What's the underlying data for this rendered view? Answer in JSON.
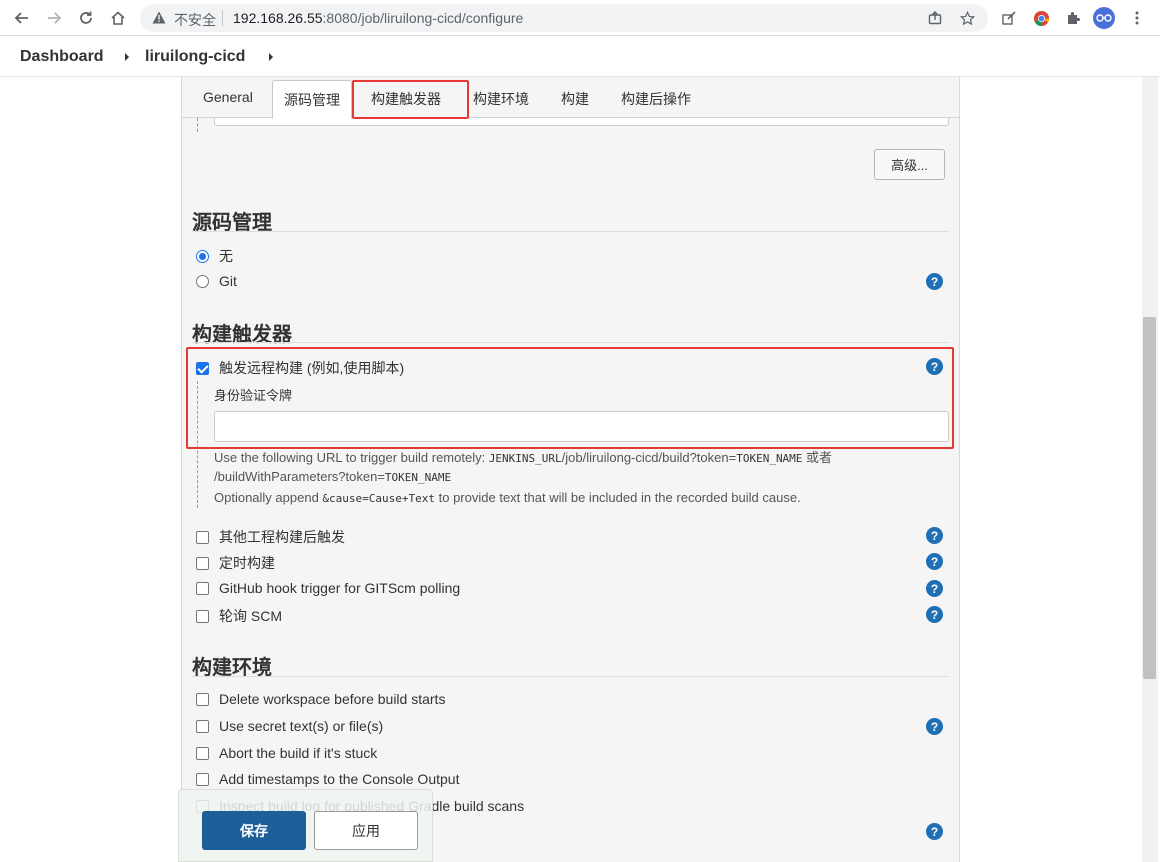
{
  "browser": {
    "insecure_label": "不安全",
    "url_host": "192.168.26.55",
    "url_rest": ":8080/job/liruilong-cicd/configure"
  },
  "breadcrumb": {
    "items": [
      "Dashboard",
      "liruilong-cicd"
    ]
  },
  "tabs": [
    "General",
    "源码管理",
    "构建触发器",
    "构建环境",
    "构建",
    "构建后操作"
  ],
  "advanced_button": "高级...",
  "scm": {
    "title": "源码管理",
    "options": [
      {
        "label": "无",
        "selected": true
      },
      {
        "label": "Git",
        "selected": false
      }
    ]
  },
  "triggers": {
    "title": "构建触发器",
    "remote": {
      "label": "触发远程构建 (例如,使用脚本)",
      "checked": true
    },
    "token_label": "身份验证令牌",
    "token_value": "",
    "help_line1_a": "Use the following URL to trigger build remotely: ",
    "help_line1_code1": "JENKINS_URL",
    "help_line1_b": "/job/liruilong-cicd/build?token=",
    "help_line1_code2": "TOKEN_NAME",
    "help_line1_c": " 或者",
    "help_line2_a": "/buildWithParameters?token=",
    "help_line2_code": "TOKEN_NAME",
    "help_line3_a": "Optionally append ",
    "help_line3_code": "&cause=Cause+Text",
    "help_line3_b": " to provide text that will be included in the recorded build cause.",
    "others": [
      {
        "label": "其他工程构建后触发",
        "checked": false
      },
      {
        "label": "定时构建",
        "checked": false
      },
      {
        "label": "GitHub hook trigger for GITScm polling",
        "checked": false
      },
      {
        "label": "轮询 SCM",
        "checked": false
      }
    ]
  },
  "build_env": {
    "title": "构建环境",
    "options": [
      {
        "label": "Delete workspace before build starts",
        "checked": false
      },
      {
        "label": "Use secret text(s) or file(s)",
        "checked": false
      },
      {
        "label": "Abort the build if it's stuck",
        "checked": false
      },
      {
        "label": "Add timestamps to the Console Output",
        "checked": false
      },
      {
        "label": "Inspect build log for published Gradle build scans",
        "checked": false
      }
    ]
  },
  "help_glyph": "?",
  "footer": {
    "save": "保存",
    "apply": "应用"
  }
}
